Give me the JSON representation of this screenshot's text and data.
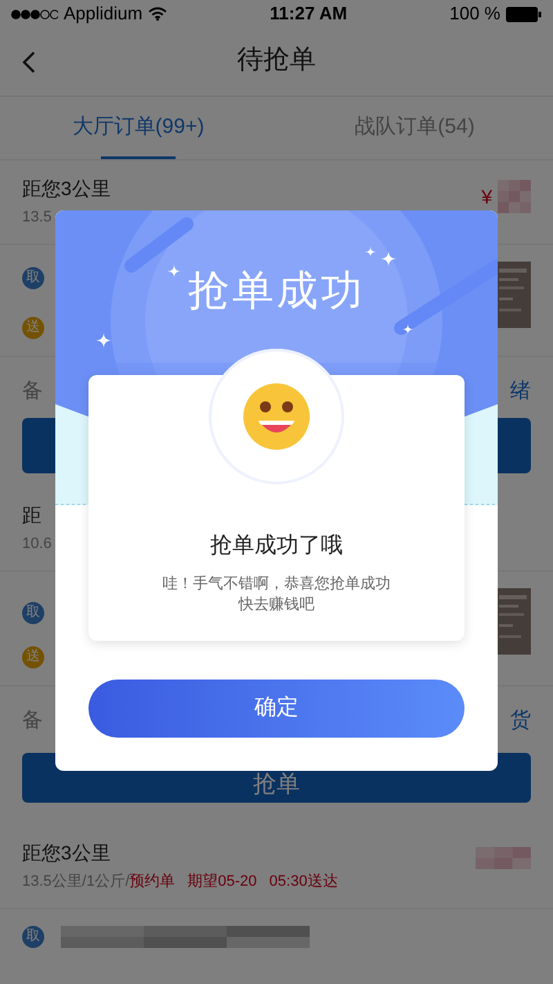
{
  "status_bar": {
    "carrier": "Applidium",
    "time": "11:27 AM",
    "battery": "100 %"
  },
  "nav": {
    "title": "待抢单"
  },
  "tabs": [
    {
      "label": "大厅订单(99+)",
      "selected": true
    },
    {
      "label": "战队订单(54)",
      "selected": false
    }
  ],
  "orders": [
    {
      "distance": "距您3公里",
      "details": "13.5",
      "price": "¥",
      "pickup_badge": "取",
      "delivery_badge": "送",
      "remark_label": "备",
      "status": "绪"
    },
    {
      "distance": "距",
      "details": "10.6",
      "pickup_badge": "取",
      "delivery_badge": "送",
      "remark_label": "备",
      "status": "货",
      "button": "抢单"
    },
    {
      "distance": "距您3公里",
      "details": "13.5公里/1公斤/",
      "tags": [
        "预约单",
        "期望05-20",
        "05:30送达"
      ],
      "pickup_badge": "取"
    }
  ],
  "dialog": {
    "banner_title": "抢单成功",
    "heading": "抢单成功了哦",
    "message_lines": [
      "哇！手气不错啊，恭喜您抢单成功",
      "快去赚钱吧"
    ],
    "confirm_button": "确定"
  }
}
